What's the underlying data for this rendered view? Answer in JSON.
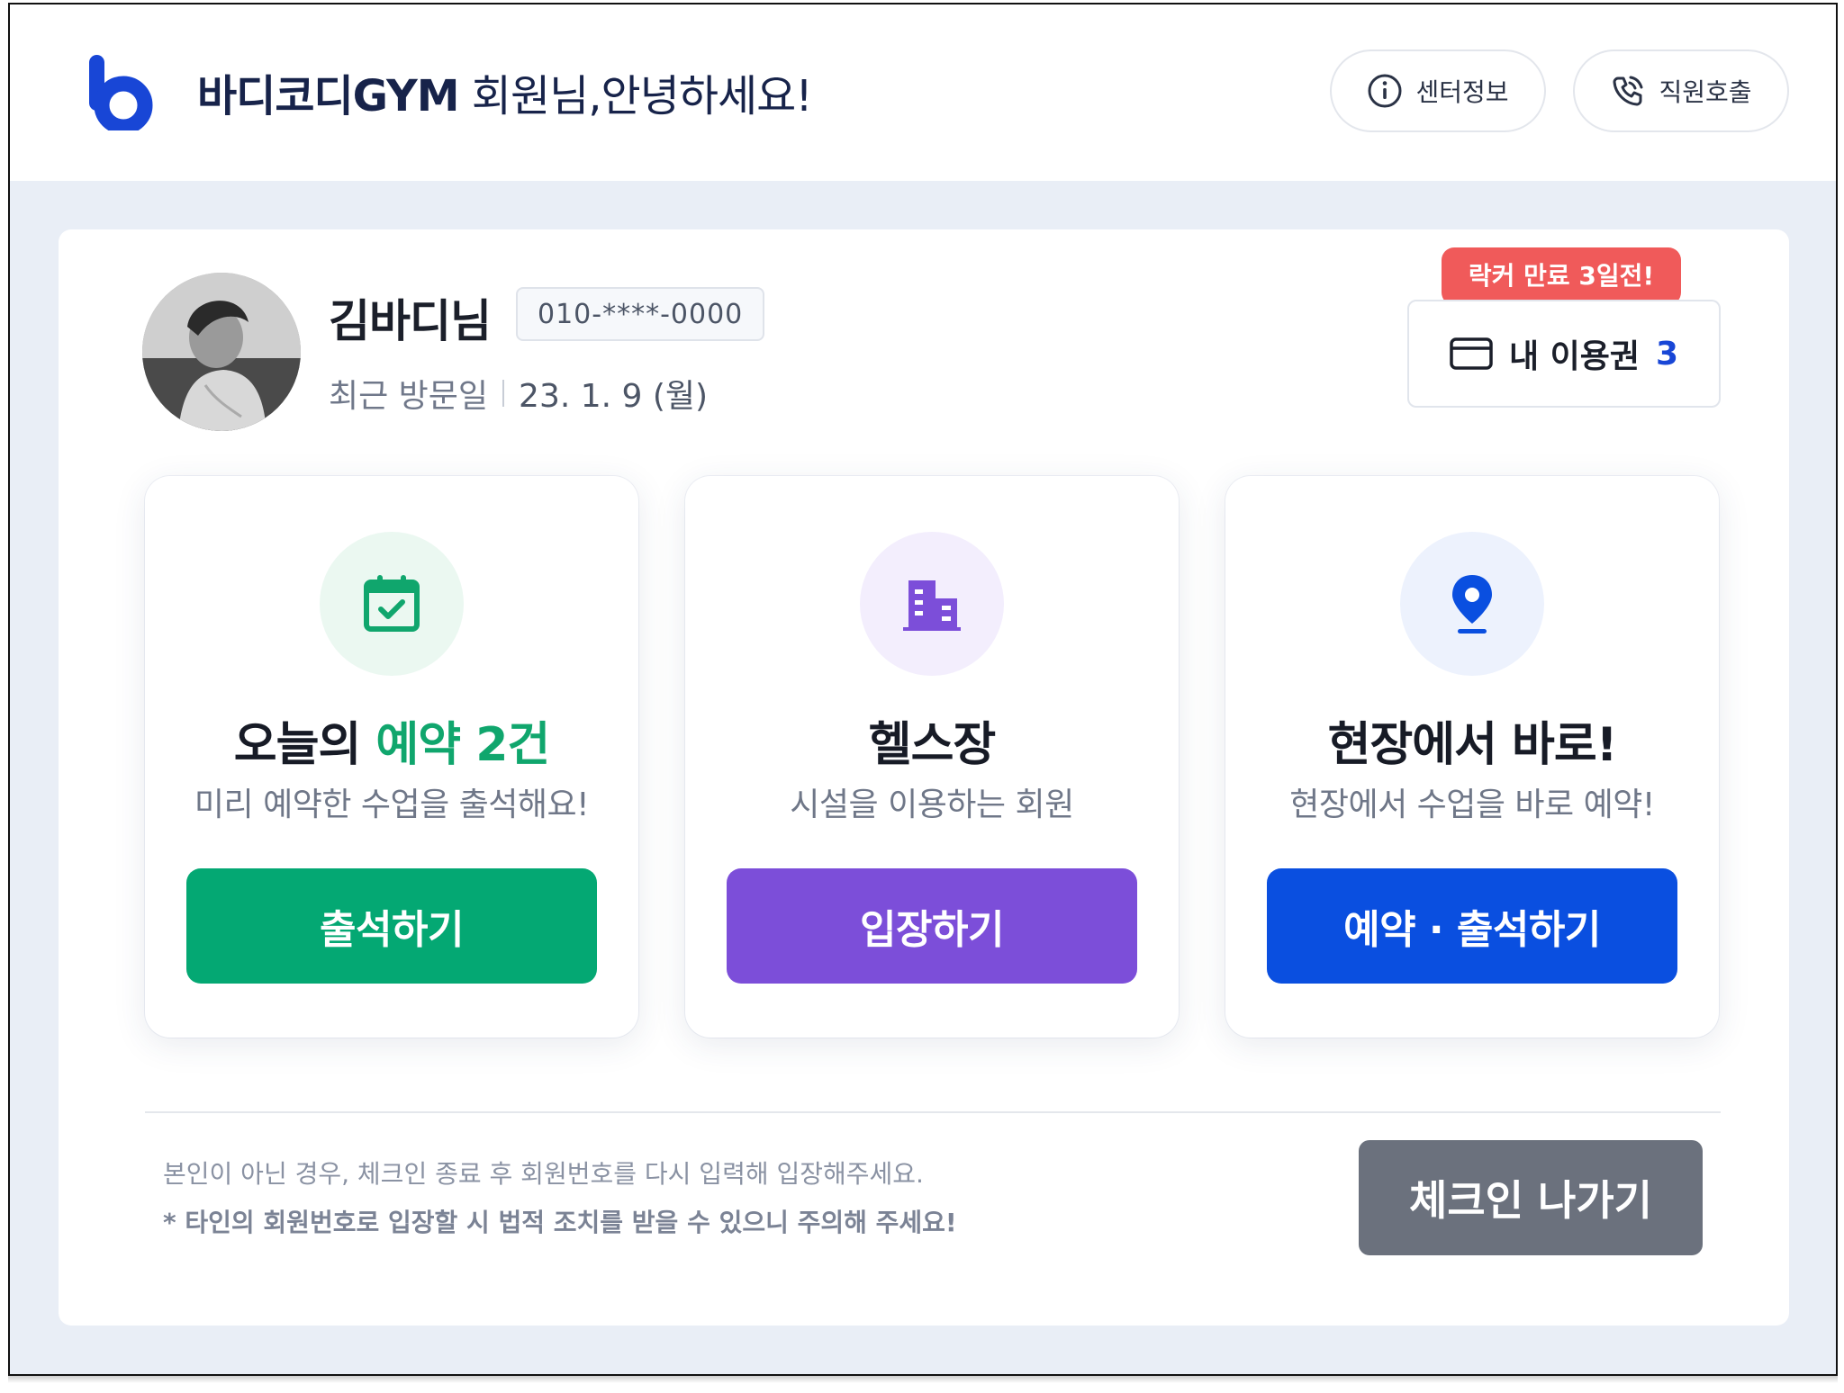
{
  "header": {
    "greeting_gym": "바디코디GYM",
    "greeting_rest": "회원님,안녕하세요!",
    "info_button": "센터정보",
    "call_button": "직원호출"
  },
  "member": {
    "name": "김바디님",
    "phone": "010-****-0000",
    "last_visit_label": "최근 방문일",
    "last_visit_date": "23. 1. 9 (월)"
  },
  "pass": {
    "locker_alert": "락커 만료 3일전!",
    "label": "내 이용권",
    "count": "3"
  },
  "features": [
    {
      "title_prefix": "오늘의",
      "title_highlight": "예약 2건",
      "description": "미리 예약한 수업을 출석해요!",
      "button": "출석하기",
      "icon": "calendar-check-icon",
      "color": "#04a873"
    },
    {
      "title": "헬스장",
      "description": "시설을 이용하는 회원",
      "button": "입장하기",
      "icon": "building-icon",
      "color": "#7c4ed9"
    },
    {
      "title": "현장에서 바로!",
      "description": "현장에서 수업을 바로 예약!",
      "button": "예약 · 출석하기",
      "icon": "location-pin-icon",
      "color": "#0a4fe0"
    }
  ],
  "footer": {
    "notice_1": "본인이 아닌 경우, 체크인 종료 후 회원번호를 다시 입력해 입장해주세요.",
    "notice_2": "* 타인의 회원번호로 입장할 시 법적 조치를 받을 수 있으니 주의해 주세요!",
    "checkout_button": "체크인 나가기"
  },
  "colors": {
    "brand": "#1846d6",
    "alert": "#f05a5a",
    "background": "#e9eef6"
  }
}
